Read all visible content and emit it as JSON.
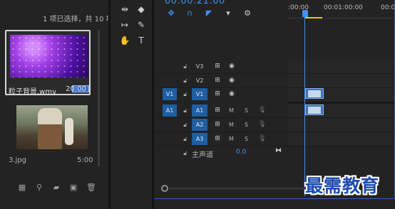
{
  "project": {
    "selection_status": "1 项已选择，共 10 项",
    "items": [
      {
        "name": "粒子背景.wmv",
        "duration": "20:00"
      },
      {
        "name": "3.jpg",
        "duration": "5:00"
      }
    ],
    "toolbar_icons": [
      "list-view-icon",
      "search-icon",
      "new-bin-icon",
      "new-item-icon",
      "trash-icon"
    ]
  },
  "tools": {
    "items": [
      "ripple-edit-tool-icon",
      "razor-tool-icon",
      "slip-tool-icon",
      "pen-tool-icon",
      "hand-tool-icon",
      "type-tool-icon"
    ]
  },
  "timeline": {
    "timecode": "00:00:21:00",
    "ruler_ticks": [
      ":00:00",
      "00:01:00:00",
      "00:02"
    ],
    "video_tracks": [
      {
        "name": "V3",
        "source": "",
        "clip": false
      },
      {
        "name": "V2",
        "source": "",
        "clip": false
      },
      {
        "name": "V1",
        "source": "V1",
        "clip": true
      }
    ],
    "audio_tracks": [
      {
        "name": "A1",
        "source": "A1",
        "m": "M",
        "s": "S",
        "clip": true
      },
      {
        "name": "A2",
        "source": "",
        "m": "M",
        "s": "S",
        "clip": false
      },
      {
        "name": "A3",
        "source": "",
        "m": "M",
        "s": "S",
        "clip": false
      }
    ],
    "master": {
      "label": "主声道",
      "value": "0.0"
    }
  },
  "watermark": "最需教育",
  "colors": {
    "accent": "#3f8ff6",
    "track_target": "#1e5ea3",
    "in_out_bar": "#e2d000"
  }
}
